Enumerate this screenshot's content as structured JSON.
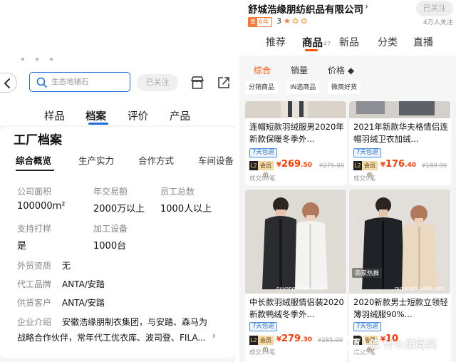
{
  "left": {
    "search": {
      "placeholder": "生态地铺石"
    },
    "follow_label": "已关注",
    "tabs": [
      "样品",
      "档案",
      "评价",
      "产品"
    ],
    "card_title": "工厂档案",
    "subtabs": [
      "综合概览",
      "生产实力",
      "合作方式",
      "车间设备"
    ],
    "metrics": [
      {
        "label": "公司面积",
        "value": "100000m²"
      },
      {
        "label": "年交易额",
        "value": "2000万以上"
      },
      {
        "label": "员工总数",
        "value": "1000人以上"
      },
      {
        "label": "支持打样",
        "value": "是"
      },
      {
        "label": "加工设备",
        "value": "1000台"
      }
    ],
    "rows": [
      {
        "label": "外贸资质",
        "value": "无"
      },
      {
        "label": "代工品牌",
        "value": "ANTA/安踏"
      },
      {
        "label": "供货客户",
        "value": "ANTA/安踏"
      },
      {
        "label": "企业介绍",
        "value": "安徽浩缘朋制衣集团，与安踏、森马为"
      }
    ],
    "intro_line2": "战略合作伙伴，常年代工优衣库、波司登、FILA...",
    "intro_chev": "›"
  },
  "right": {
    "shop_name": "舒城浩缘朋纺织品有限公司",
    "shop_chev": "›",
    "follow_label": "已关注",
    "years": "6年",
    "years_icon": "皇",
    "rating": "3",
    "fans": "4万人关注",
    "tabs": [
      "推荐",
      "商品",
      "新品",
      "分类",
      "直播"
    ],
    "tab_count": "47",
    "sorts": [
      "综合",
      "销量",
      "价格 ◆"
    ],
    "chips": [
      "分销商品",
      "IN选商品",
      "微商好货"
    ],
    "products": [
      {
        "title": "连帽短款羽绒服男2020年新款保暖冬季外...",
        "tag": "7天包退",
        "l2a": "L2",
        "l2b": "会员价",
        "yen": "¥",
        "int": "269",
        "dec": ".50",
        "orig": "¥275.00",
        "sold": "成交88笔"
      },
      {
        "title": "2021年新款华夫格情侣连帽羽绒卫衣加绒...",
        "tag": "7天包退",
        "l2a": "L2",
        "l2b": "会员价",
        "yen": "¥",
        "int": "176",
        "dec": ".40",
        "orig": "¥189.90",
        "sold": "成交0笔"
      },
      {
        "title": "中长款羽绒服情侣装2020新款鸭绒冬季外...",
        "tag": "7天包退",
        "l2a": "L2",
        "l2b": "会员价",
        "yen": "¥",
        "int": "279",
        "dec": ".30",
        "orig": "¥285.00",
        "sold": "成交14笔",
        "img_caption": "nuyangfs.1688.com"
      },
      {
        "title": "2020新款男士短款立领轻薄羽绒服90%...",
        "tag": "7天包退",
        "l2a": "L2",
        "l2b": "会员价",
        "yen": "¥",
        "int": "10",
        "dec": "",
        "orig": "",
        "sold": "成交5笔",
        "img_tag": "商家热推",
        "img_caption": "nuyangfs.1688.com"
      }
    ]
  },
  "watermark": "值 什么值得买",
  "colors": {
    "accent": "#ff5000",
    "blue": "#1f6fd8",
    "price": "#ff3b00"
  }
}
